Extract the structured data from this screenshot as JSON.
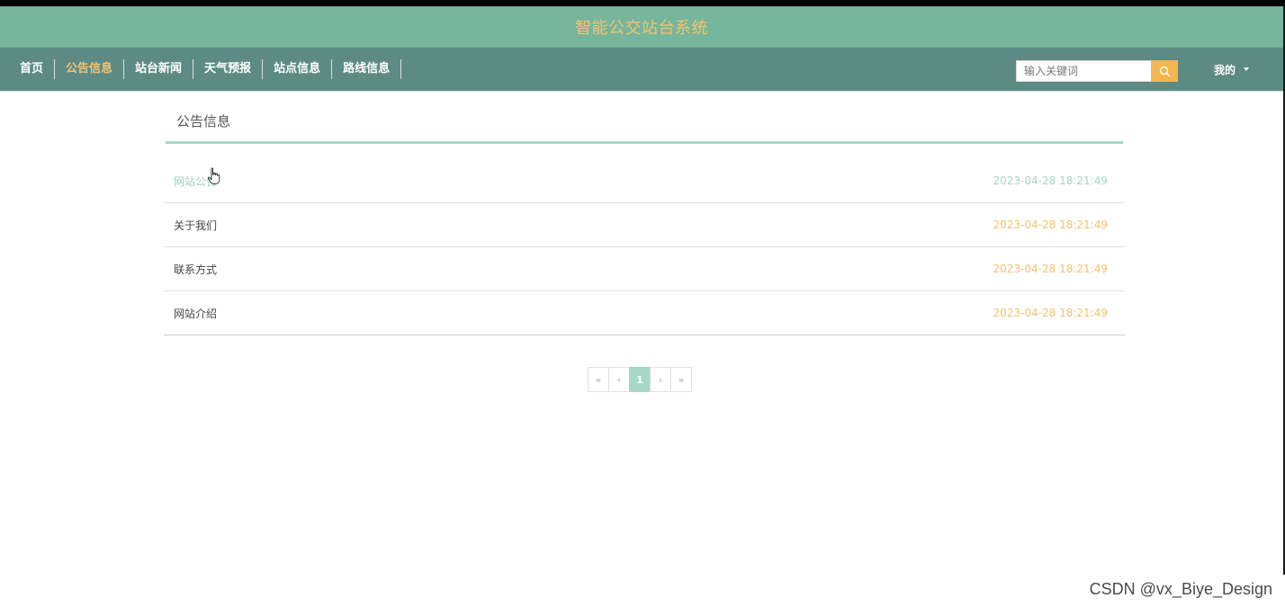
{
  "header": {
    "site_title": "智能公交站台系统"
  },
  "nav": {
    "items": [
      {
        "label": "首页",
        "active": false
      },
      {
        "label": "公告信息",
        "active": true
      },
      {
        "label": "站台新闻",
        "active": false
      },
      {
        "label": "天气预报",
        "active": false
      },
      {
        "label": "站点信息",
        "active": false
      },
      {
        "label": "路线信息",
        "active": false
      }
    ]
  },
  "search": {
    "placeholder": "输入关键词",
    "value": "",
    "icon": "search-icon"
  },
  "user_menu": {
    "label": "我的",
    "icon": "caret-down-icon"
  },
  "main": {
    "section_title": "公告信息",
    "notices": [
      {
        "title": "网站公告",
        "date": "2023-04-28 18:21:49",
        "hovered": true
      },
      {
        "title": "关于我们",
        "date": "2023-04-28 18:21:49",
        "hovered": false
      },
      {
        "title": "联系方式",
        "date": "2023-04-28 18:21:49",
        "hovered": false
      },
      {
        "title": "网站介绍",
        "date": "2023-04-28 18:21:49",
        "hovered": false
      }
    ]
  },
  "pagination": {
    "first": "«",
    "prev": "‹",
    "current": "1",
    "next": "›",
    "last": "»"
  },
  "watermark": {
    "text": "CSDN @vx_Biye_Design"
  },
  "colors": {
    "title_bar": "#76b69c",
    "nav_bar": "#5d8b84",
    "accent": "#f3c26f",
    "mint": "#a6d9c5"
  }
}
